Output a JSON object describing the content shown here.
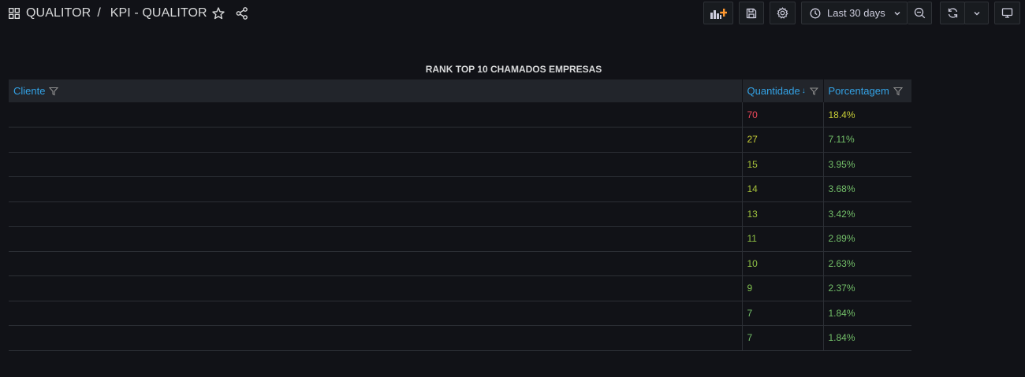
{
  "header": {
    "folder": "QUALITOR",
    "separator": "/",
    "dashboard": "KPI - QUALITOR",
    "time_range": "Last 30 days"
  },
  "icons": {
    "grid": "dashboards-grid-icon",
    "star": "star-icon",
    "share": "share-icon",
    "add_panel": "add-panel-icon",
    "save": "save-icon",
    "settings": "gear-icon",
    "clock": "clock-icon",
    "zoom_out": "zoom-out-icon",
    "refresh": "refresh-icon",
    "tv": "tv-mode-icon"
  },
  "colors": {
    "accent_orange": "#ff9830",
    "header_blue": "#33a2e5",
    "value_red": "#f2495c",
    "value_yellowgreen": "#c8ce37",
    "value_green": "#73bf69"
  },
  "panel": {
    "title": "RANK TOP 10 CHAMADOS EMPRESAS",
    "columns": [
      "Cliente",
      "Quantidade",
      "Porcentagem"
    ],
    "rows": [
      {
        "cliente": "",
        "quantidade": "70",
        "porcentagem": "18.4%",
        "q_color": "#f2495c",
        "p_color": "#c8ce37"
      },
      {
        "cliente": "",
        "quantidade": "27",
        "porcentagem": "7.11%",
        "q_color": "#c8ce37",
        "p_color": "#73bf69"
      },
      {
        "cliente": "",
        "quantidade": "15",
        "porcentagem": "3.95%",
        "q_color": "#a7c23a",
        "p_color": "#73bf69"
      },
      {
        "cliente": "",
        "quantidade": "14",
        "porcentagem": "3.68%",
        "q_color": "#a7c23a",
        "p_color": "#73bf69"
      },
      {
        "cliente": "",
        "quantidade": "13",
        "porcentagem": "3.42%",
        "q_color": "#9fc23e",
        "p_color": "#73bf69"
      },
      {
        "cliente": "",
        "quantidade": "11",
        "porcentagem": "2.89%",
        "q_color": "#8fc145",
        "p_color": "#73bf69"
      },
      {
        "cliente": "",
        "quantidade": "10",
        "porcentagem": "2.63%",
        "q_color": "#8fc145",
        "p_color": "#73bf69"
      },
      {
        "cliente": "",
        "quantidade": "9",
        "porcentagem": "2.37%",
        "q_color": "#80c04f",
        "p_color": "#73bf69"
      },
      {
        "cliente": "",
        "quantidade": "7",
        "porcentagem": "1.84%",
        "q_color": "#73bf69",
        "p_color": "#73bf69"
      },
      {
        "cliente": "",
        "quantidade": "7",
        "porcentagem": "1.84%",
        "q_color": "#73bf69",
        "p_color": "#73bf69"
      }
    ]
  }
}
